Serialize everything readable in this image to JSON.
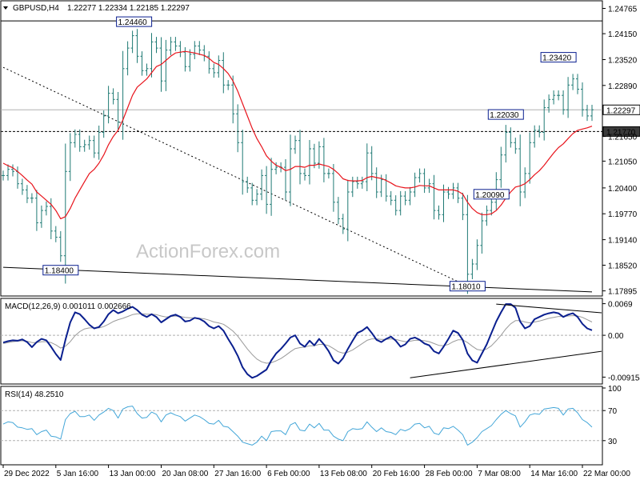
{
  "colors": {
    "price": "#1f7a74",
    "ma": "#e8141c",
    "macd": "#0a1f8f",
    "signal": "#9a9a9a",
    "rsi": "#43a6d8",
    "grid": "#000000"
  },
  "header": {
    "symbol": "GBPUSD,H4",
    "ohlc": "1.22277 1.22334 1.22185 1.22297",
    "macd_label": "MACD(12,26,9) 0.001011 0.002666",
    "rsi_label": "RSI(14) 48.2510",
    "watermark": "ActionForex.com"
  },
  "chart_data": [
    {
      "type": "candlestick",
      "panel": "price",
      "ylim": [
        1.1781,
        1.2491
      ],
      "y_ticks": [
        "1.24765",
        "1.24150",
        "1.23520",
        "1.22890",
        "1.22297",
        "1.21770",
        "1.21650",
        "1.21050",
        "1.20400",
        "1.19770",
        "1.19140",
        "1.18520",
        "1.17895"
      ],
      "y_tick_values": [
        1.24765,
        1.2415,
        1.2352,
        1.2289,
        1.22297,
        1.2177,
        1.2165,
        1.2105,
        1.204,
        1.1977,
        1.1914,
        1.1852,
        1.17895
      ],
      "current_price": {
        "value": 1.22297,
        "label": "1.22297"
      },
      "support_level": {
        "value": 1.2177,
        "label": "1.21770"
      },
      "resistance_level": {
        "value": 1.2446
      },
      "annotations": [
        {
          "label": "1.24460",
          "index": 27,
          "value": 1.2446
        },
        {
          "label": "1.18400",
          "index": 12,
          "value": 1.184
        },
        {
          "label": "1.18010",
          "index": 97,
          "value": 1.1801
        },
        {
          "label": "1.22030",
          "index": 105,
          "value": 1.2203
        },
        {
          "label": "1.20090",
          "index": 102,
          "value": 1.2009
        },
        {
          "label": "1.23420",
          "index": 116,
          "value": 1.2342
        }
      ],
      "trendlines": [
        {
          "from": {
            "index": 0,
            "value": 1.2333
          },
          "to": {
            "index": 97,
            "value": 1.1801
          },
          "style": "dotted"
        },
        {
          "from": {
            "index": 0,
            "value": 1.1847
          },
          "to": {
            "index": 123,
            "value": 1.1787
          },
          "style": "solid"
        }
      ],
      "x": [
        "29 Dec 2022",
        "5 Jan 16:00",
        "13 Jan 00:00",
        "20 Jan 08:00",
        "27 Jan 16:00",
        "6 Feb 00:00",
        "13 Feb 08:00",
        "20 Feb 16:00",
        "28 Feb 00:00",
        "7 Mar 08:00",
        "14 Mar 16:00",
        "22 Mar 00:00"
      ],
      "x_index": [
        0,
        11,
        22,
        33,
        44,
        55,
        66,
        77,
        88,
        99,
        110,
        121
      ],
      "series": [
        {
          "kind": "close",
          "values": [
            1.207,
            1.2085,
            1.208,
            1.205,
            1.2035,
            1.2015,
            1.2015,
            1.1955,
            1.1985,
            1.1995,
            1.1935,
            1.192,
            1.1875,
            1.208,
            1.215,
            1.217,
            1.214,
            1.2145,
            1.2155,
            1.2125,
            1.2175,
            1.2215,
            1.227,
            1.2255,
            1.22,
            1.233,
            1.238,
            1.241,
            1.236,
            1.2325,
            1.233,
            1.2395,
            1.238,
            1.23,
            1.2375,
            1.2395,
            1.2385,
            1.237,
            1.2335,
            1.2365,
            1.2385,
            1.2375,
            1.236,
            1.233,
            1.232,
            1.235,
            1.229,
            1.229,
            1.222,
            1.215,
            1.2055,
            1.204,
            1.201,
            1.2025,
            1.207,
            1.2,
            1.2085,
            1.209,
            1.209,
            1.203,
            1.2135,
            1.2155,
            1.2075,
            1.207,
            1.2135,
            1.21,
            1.214,
            1.2075,
            1.2075,
            1.2005,
            1.1965,
            1.194,
            1.203,
            1.2055,
            1.205,
            1.2055,
            1.2125,
            1.2075,
            1.203,
            1.206,
            1.202,
            1.201,
            1.1985,
            1.202,
            1.201,
            1.203,
            1.2065,
            1.2075,
            1.204,
            1.205,
            1.1985,
            1.1975,
            1.203,
            1.2025,
            1.204,
            1.2015,
            1.1975,
            1.183,
            1.1855,
            1.19,
            1.196,
            1.1985,
            1.2005,
            1.206,
            1.212,
            1.2175,
            1.215,
            1.2135,
            1.203,
            1.2075,
            1.215,
            1.218,
            1.2175,
            1.2235,
            1.2255,
            1.2265,
            1.2265,
            1.223,
            1.229,
            1.2305,
            1.228,
            1.223,
            1.2215,
            1.223
          ]
        },
        {
          "kind": "ma",
          "values": [
            1.21,
            1.2094,
            1.2089,
            1.208,
            1.207,
            1.2059,
            1.2049,
            1.203,
            1.202,
            1.201,
            1.2,
            1.1985,
            1.1965,
            1.197,
            1.199,
            1.2015,
            1.2035,
            1.2055,
            1.2075,
            1.2085,
            1.21,
            1.212,
            1.2145,
            1.2165,
            1.218,
            1.2205,
            1.2235,
            1.2265,
            1.2285,
            1.2295,
            1.2305,
            1.232,
            1.2335,
            1.234,
            1.235,
            1.236,
            1.2368,
            1.237,
            1.2372,
            1.237,
            1.2368,
            1.2365,
            1.2362,
            1.2355,
            1.2345,
            1.234,
            1.233,
            1.2318,
            1.23,
            1.2275,
            1.2245,
            1.2215,
            1.2185,
            1.216,
            1.214,
            1.2118,
            1.2105,
            1.2095,
            1.209,
            1.2082,
            1.2085,
            1.2092,
            1.2092,
            1.209,
            1.2095,
            1.2095,
            1.2098,
            1.2095,
            1.2092,
            1.2085,
            1.2075,
            1.2062,
            1.2058,
            1.2057,
            1.2057,
            1.2058,
            1.2065,
            1.2068,
            1.2065,
            1.2063,
            1.2058,
            1.2052,
            1.2045,
            1.2042,
            1.204,
            1.204,
            1.2042,
            1.2046,
            1.2045,
            1.2045,
            1.204,
            1.2035,
            1.2035,
            1.2035,
            1.2035,
            1.2032,
            1.2025,
            1.2005,
            1.199,
            1.198,
            1.1975,
            1.1975,
            1.1977,
            1.1985,
            1.1998,
            1.2015,
            1.203,
            1.2042,
            1.2045,
            1.205,
            1.206,
            1.2072,
            1.2082,
            1.2095,
            1.211,
            1.2125,
            1.2138,
            1.2147,
            1.216,
            1.2172,
            1.218,
            1.2183,
            1.2186,
            1.219
          ]
        }
      ]
    },
    {
      "type": "line",
      "panel": "macd",
      "ylim": [
        -0.0103,
        0.0077
      ],
      "y_ticks": [
        "0.0069",
        "0.00",
        "-0.009154"
      ],
      "y_tick_values": [
        0.0069,
        0.0,
        -0.009154
      ],
      "trendlines": [
        {
          "from": {
            "index": 85,
            "value": -0.0093
          },
          "to": {
            "index": 123,
            "value": -0.0035
          },
          "style": "solid"
        },
        {
          "from": {
            "index": 103,
            "value": 0.0068
          },
          "to": {
            "index": 123,
            "value": 0.0049
          },
          "style": "solid"
        }
      ],
      "series": [
        {
          "kind": "macd",
          "values": [
            -0.0016,
            -0.0013,
            -0.0011,
            -0.0012,
            -0.0009,
            -0.0015,
            -0.0026,
            -0.0015,
            -0.0008,
            -0.0011,
            -0.0025,
            -0.0041,
            -0.0054,
            -0.001,
            0.0028,
            0.005,
            0.0046,
            0.0035,
            0.0023,
            0.0015,
            0.0018,
            0.003,
            0.0046,
            0.0055,
            0.0048,
            0.0052,
            0.0058,
            0.0062,
            0.0055,
            0.0045,
            0.004,
            0.0046,
            0.004,
            0.0028,
            0.0035,
            0.0042,
            0.0045,
            0.004,
            0.003,
            0.0032,
            0.0038,
            0.0036,
            0.003,
            0.002,
            0.0015,
            0.002,
            0.001,
            -0.0008,
            -0.0025,
            -0.0045,
            -0.007,
            -0.0085,
            -0.0093,
            -0.0089,
            -0.0082,
            -0.0075,
            -0.0055,
            -0.004,
            -0.003,
            -0.0018,
            -0.0005,
            0.0,
            -0.0018,
            -0.0025,
            -0.0012,
            -0.0022,
            -0.0008,
            -0.002,
            -0.0035,
            -0.0055,
            -0.0062,
            -0.005,
            -0.003,
            -0.0012,
            0.0005,
            0.001,
            0.0018,
            0.0005,
            -0.001,
            -0.0015,
            -0.0008,
            -0.0003,
            -0.0012,
            -0.0025,
            -0.002,
            -0.0008,
            -0.0005,
            -0.001,
            -0.0018,
            -0.0022,
            -0.0035,
            -0.004,
            -0.0025,
            -0.0008,
            0.001,
            0.0005,
            -0.001,
            -0.004,
            -0.0055,
            -0.006,
            -0.004,
            -0.002,
            0.0005,
            0.003,
            0.005,
            0.0068,
            0.0068,
            0.006,
            0.003,
            0.0015,
            0.002,
            0.0035,
            0.004,
            0.0045,
            0.0048,
            0.005,
            0.0048,
            0.004,
            0.0045,
            0.0048,
            0.004,
            0.0025,
            0.0015,
            0.0011
          ]
        },
        {
          "kind": "signal",
          "values": [
            -0.0018,
            -0.0016,
            -0.0014,
            -0.0013,
            -0.0012,
            -0.0013,
            -0.0016,
            -0.0016,
            -0.0014,
            -0.0014,
            -0.0016,
            -0.0021,
            -0.0028,
            -0.0024,
            -0.0014,
            -0.0001,
            0.0008,
            0.0014,
            0.0016,
            0.0016,
            0.0016,
            0.0019,
            0.0024,
            0.003,
            0.0034,
            0.0037,
            0.0041,
            0.0045,
            0.0047,
            0.0047,
            0.0046,
            0.0046,
            0.0045,
            0.0042,
            0.004,
            0.0041,
            0.0042,
            0.0041,
            0.0039,
            0.0038,
            0.0038,
            0.0037,
            0.0036,
            0.0033,
            0.0029,
            0.0027,
            0.0024,
            0.0017,
            0.0009,
            -0.0002,
            -0.0016,
            -0.003,
            -0.0042,
            -0.0052,
            -0.0058,
            -0.0061,
            -0.006,
            -0.0056,
            -0.0051,
            -0.0044,
            -0.0036,
            -0.0029,
            -0.0027,
            -0.0026,
            -0.0023,
            -0.0023,
            -0.002,
            -0.002,
            -0.0023,
            -0.0029,
            -0.0036,
            -0.0039,
            -0.0037,
            -0.0032,
            -0.0025,
            -0.0018,
            -0.0011,
            -0.0008,
            -0.0008,
            -0.0009,
            -0.0009,
            -0.0008,
            -0.0009,
            -0.0012,
            -0.0014,
            -0.0013,
            -0.0011,
            -0.0011,
            -0.0012,
            -0.0014,
            -0.0018,
            -0.0022,
            -0.0023,
            -0.002,
            -0.0014,
            -0.001,
            -0.001,
            -0.0016,
            -0.0024,
            -0.0031,
            -0.0033,
            -0.003,
            -0.0023,
            -0.0012,
            0.0,
            0.0014,
            0.0025,
            0.0032,
            0.0032,
            0.0029,
            0.0027,
            0.0029,
            0.0031,
            0.0034,
            0.0037,
            0.0039,
            0.0041,
            0.0041,
            0.0042,
            0.0043,
            0.0042,
            0.0039,
            0.0034,
            0.0029
          ]
        }
      ]
    },
    {
      "type": "line",
      "panel": "rsi",
      "ylim": [
        0,
        100
      ],
      "y_ticks": [
        "100",
        "70",
        "30"
      ],
      "y_tick_values": [
        100,
        70,
        30
      ],
      "levels": [
        70,
        30
      ],
      "series": [
        {
          "kind": "rsi",
          "values": [
            52,
            55,
            54,
            48,
            47,
            45,
            46,
            38,
            42,
            44,
            36,
            35,
            32,
            58,
            66,
            69,
            62,
            62,
            64,
            57,
            64,
            68,
            73,
            70,
            60,
            72,
            75,
            76,
            66,
            60,
            61,
            68,
            65,
            55,
            64,
            67,
            64,
            62,
            56,
            60,
            64,
            62,
            58,
            53,
            52,
            57,
            49,
            48,
            42,
            36,
            28,
            26,
            24,
            28,
            36,
            30,
            42,
            43,
            43,
            38,
            51,
            54,
            44,
            43,
            52,
            47,
            53,
            44,
            44,
            36,
            32,
            30,
            42,
            46,
            45,
            46,
            55,
            48,
            42,
            47,
            42,
            41,
            38,
            45,
            43,
            46,
            52,
            53,
            47,
            49,
            40,
            38,
            47,
            46,
            49,
            44,
            38,
            24,
            28,
            34,
            42,
            46,
            50,
            58,
            65,
            70,
            66,
            63,
            48,
            55,
            64,
            66,
            65,
            72,
            73,
            74,
            73,
            64,
            72,
            73,
            67,
            58,
            54,
            48
          ]
        }
      ]
    }
  ]
}
